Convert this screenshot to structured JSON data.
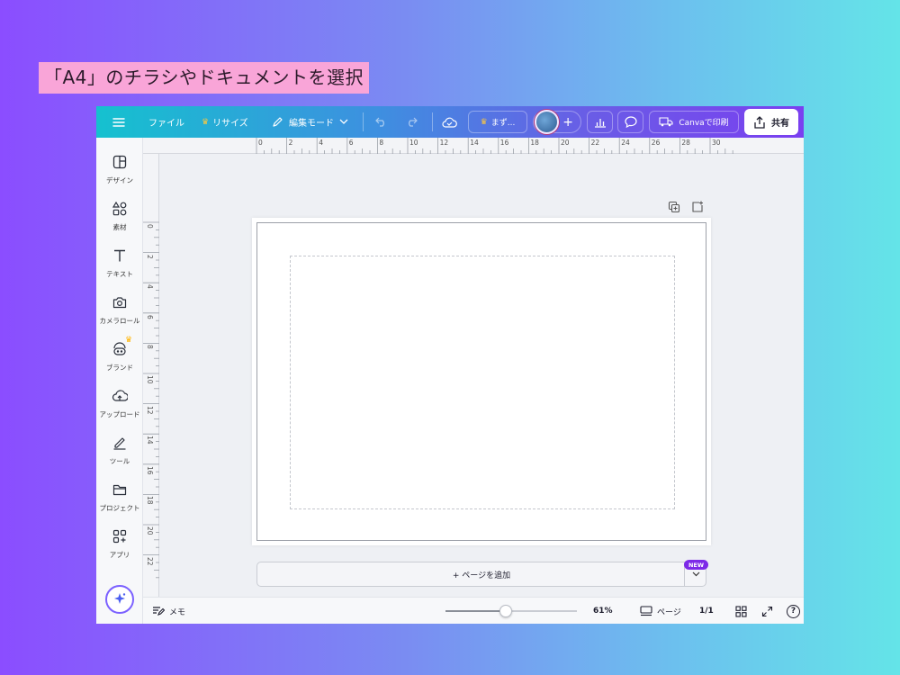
{
  "caption": "「A4」のチラシやドキュメントを選択",
  "topbar": {
    "menu_icon": "hamburger-icon",
    "file_label": "ファイル",
    "resize_label": "リサイズ",
    "edit_mode_label": "編集モード",
    "trial_label": "まず...",
    "print_label": "Canvaで印刷",
    "share_label": "共有",
    "accent_crown": "#ffc83d"
  },
  "sidebar": {
    "items": [
      {
        "label": "デザイン",
        "icon": "design-icon"
      },
      {
        "label": "素材",
        "icon": "elements-icon"
      },
      {
        "label": "テキスト",
        "icon": "text-icon"
      },
      {
        "label": "カメラロール",
        "icon": "camera-icon"
      },
      {
        "label": "ブランド",
        "icon": "brand-icon"
      },
      {
        "label": "アップロード",
        "icon": "upload-icon"
      },
      {
        "label": "ツール",
        "icon": "tools-icon"
      },
      {
        "label": "プロジェクト",
        "icon": "folder-icon"
      },
      {
        "label": "アプリ",
        "icon": "apps-icon"
      }
    ]
  },
  "ruler": {
    "top": [
      "0",
      "2",
      "4",
      "6",
      "8",
      "10",
      "12",
      "14",
      "16",
      "18",
      "20",
      "22",
      "24",
      "26",
      "28",
      "30"
    ],
    "left": [
      "0",
      "2",
      "4",
      "6",
      "8",
      "10",
      "12",
      "14",
      "16",
      "18",
      "20",
      "22"
    ]
  },
  "canvas": {
    "add_page_label": "+ ページを追加",
    "new_badge": "NEW"
  },
  "bottombar": {
    "notes_label": "メモ",
    "zoom_value": "61%",
    "zoom_level": 0.46,
    "pages_label": "ページ",
    "page_count": "1/1",
    "help_label": "?"
  }
}
